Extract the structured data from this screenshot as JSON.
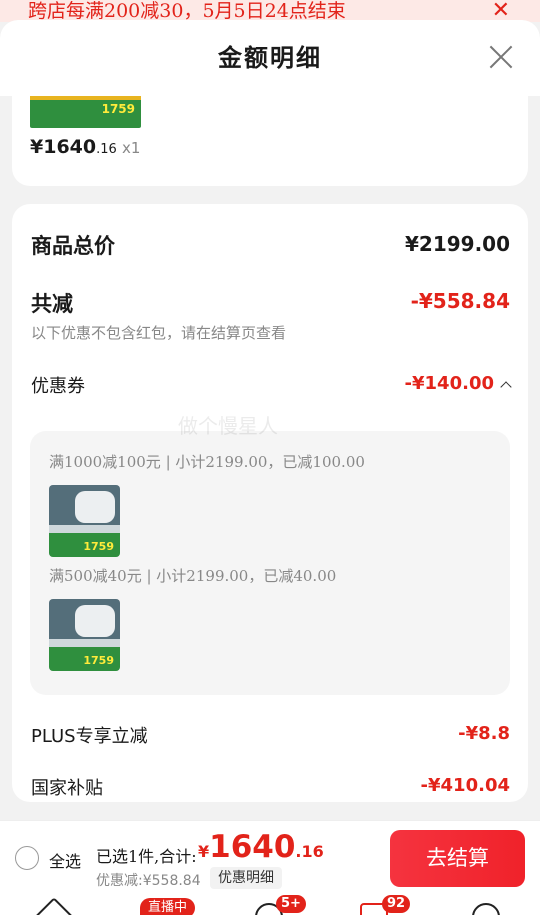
{
  "promo": {
    "text": "跨店每满200减30，5月5日24点结束",
    "close": "✕"
  },
  "sheet": {
    "title": "金额明细"
  },
  "product": {
    "price_int": "¥1640",
    "price_dec": ".16",
    "quantity": "x1",
    "thumb_text": "1759"
  },
  "detail": {
    "total_label": "商品总价",
    "total_value": "¥2199.00",
    "reduction_label": "共减",
    "reduction_value": "-¥558.84",
    "note": "以下优惠不包含红包，请在结算页查看",
    "coupon_label": "优惠券",
    "coupon_value": "-¥140.00",
    "coupons": [
      {
        "text": "满1000减100元 | 小计2199.00，已减100.00",
        "thumb_price": "1759"
      },
      {
        "text": "满500减40元 | 小计2199.00，已减40.00",
        "thumb_price": "1759"
      }
    ],
    "plus_label": "PLUS专享立减",
    "plus_value": "-¥8.8",
    "subsidy_label": "国家补贴",
    "subsidy_value": "-¥410.04"
  },
  "watermark": "做个慢星人",
  "bottom": {
    "select_all": "全选",
    "selected_text": "已选1件,合计:",
    "total_yen": "¥",
    "total_int": "1640",
    "total_dec": ".16",
    "discount_text": "优惠减:¥558.84",
    "detail_button": "优惠明细",
    "checkout_button": "去结算"
  },
  "nav": {
    "live_badge": "直播中",
    "msg_badge": "5+",
    "cart_badge": "92"
  }
}
